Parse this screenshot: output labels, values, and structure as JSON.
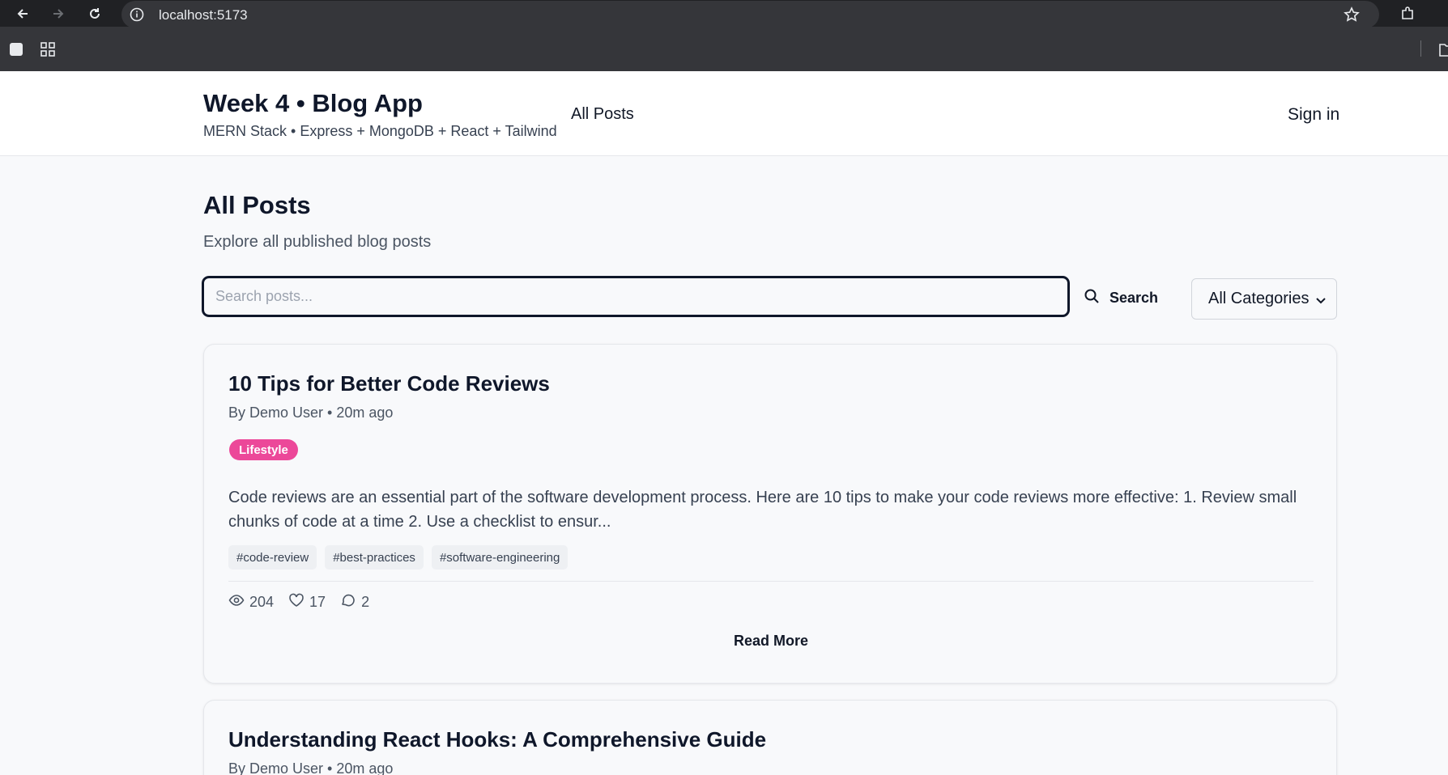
{
  "browser": {
    "url": "localhost:5173"
  },
  "header": {
    "title": "Week 4 • Blog App",
    "subtitle": "MERN Stack • Express + MongoDB + React + Tailwind",
    "nav_all_posts": "All Posts",
    "sign_in": "Sign in"
  },
  "main": {
    "title": "All Posts",
    "subtitle": "Explore all published blog posts",
    "search": {
      "placeholder": "Search posts...",
      "button_label": "Search"
    },
    "category_select": {
      "selected": "All Categories"
    },
    "posts": [
      {
        "title": "10 Tips for Better Code Reviews",
        "meta": "By Demo User • 20m ago",
        "category": "Lifestyle",
        "category_color": "#ec4899",
        "excerpt": "Code reviews are an essential part of the software development process. Here are 10 tips to make your code reviews more effective: 1. Review small chunks of code at a time 2. Use a checklist to ensur...",
        "tags": [
          "#code-review",
          "#best-practices",
          "#software-engineering"
        ],
        "views": "204",
        "likes": "17",
        "comments": "2",
        "read_more": "Read More"
      },
      {
        "title": "Understanding React Hooks: A Comprehensive Guide",
        "meta": "By Demo User • 20m ago"
      }
    ]
  }
}
